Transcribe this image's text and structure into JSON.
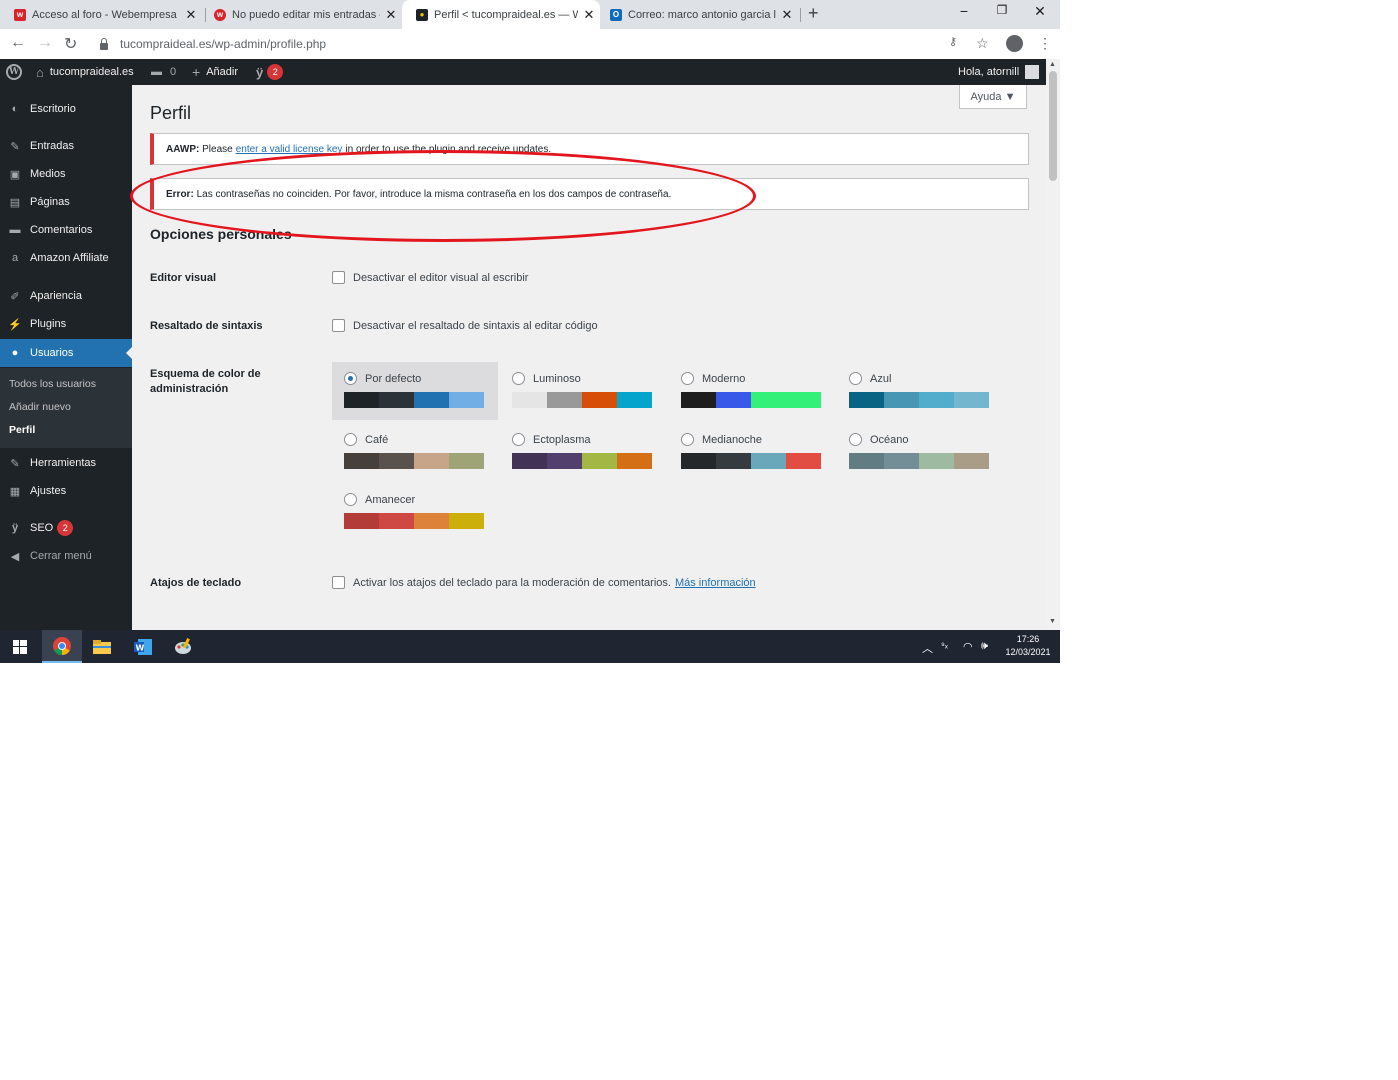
{
  "browser": {
    "tabs": [
      {
        "title": "Acceso al foro - Webempresa Eu",
        "favicon_color": "#d8232a",
        "favicon_glyph": "w"
      },
      {
        "title": "No puedo editar mis entradas – I",
        "favicon_color": "#d8232a",
        "favicon_glyph": "w"
      },
      {
        "title": "Perfil < tucompraideal.es — Wor",
        "favicon_color": "#1d2327",
        "favicon_glyph": "●"
      },
      {
        "title": "Correo: marco antonio garcia leo",
        "favicon_color": "#0f6cbd",
        "favicon_glyph": "O"
      }
    ],
    "new_tab": "+",
    "window_controls": {
      "minimize": "−",
      "restore": "❐",
      "close": "✕"
    },
    "url": "tucompraideal.es/wp-admin/profile.php"
  },
  "admin_bar": {
    "site_name": "tucompraideal.es",
    "comments_count": "0",
    "add_new": "Añadir",
    "seo_count": "2",
    "greeting": "Hola, atornill"
  },
  "sidebar": {
    "items": [
      {
        "label": "Escritorio",
        "icon": "dashboard-icon",
        "glyph": "◐"
      },
      {
        "label": "Entradas",
        "icon": "pin-icon",
        "glyph": "✎"
      },
      {
        "label": "Medios",
        "icon": "media-icon",
        "glyph": "▣"
      },
      {
        "label": "Páginas",
        "icon": "pages-icon",
        "glyph": "▤"
      },
      {
        "label": "Comentarios",
        "icon": "comment-icon",
        "glyph": "▬"
      },
      {
        "label": "Amazon Affiliate",
        "icon": "amazon-icon",
        "glyph": "a"
      },
      {
        "label": "Apariencia",
        "icon": "brush-icon",
        "glyph": "✐"
      },
      {
        "label": "Plugins",
        "icon": "plugin-icon",
        "glyph": "⚡"
      },
      {
        "label": "Usuarios",
        "icon": "users-icon",
        "glyph": "●"
      },
      {
        "label": "Herramientas",
        "icon": "wrench-icon",
        "glyph": "✎"
      },
      {
        "label": "Ajustes",
        "icon": "settings-icon",
        "glyph": "▦"
      },
      {
        "label": "SEO",
        "icon": "yoast-icon",
        "glyph": "ÿ",
        "badge": "2"
      },
      {
        "label": "Cerrar menú",
        "icon": "collapse-icon",
        "glyph": "◀"
      }
    ],
    "submenu": [
      "Todos los usuarios",
      "Añadir nuevo",
      "Perfil"
    ]
  },
  "content": {
    "help_label": "Ayuda ▼",
    "title": "Perfil",
    "notice_aawp": {
      "strong": "AAWP:",
      "before": "Please",
      "link": "enter a valid license key",
      "after": "in order to use the plugin and receive updates."
    },
    "notice_error": {
      "strong": "Error:",
      "text": "Las contraseñas no coinciden. Por favor, introduce la misma contraseña en los dos campos de contraseña."
    },
    "section_title": "Opciones personales",
    "editor_visual": {
      "label": "Editor visual",
      "option": "Desactivar el editor visual al escribir"
    },
    "syntax": {
      "label": "Resaltado de sintaxis",
      "option": "Desactivar el resaltado de sintaxis al editar código"
    },
    "color_scheme_label": "Esquema de color de administración",
    "color_schemes": [
      {
        "name": "Por defecto",
        "selected": true,
        "colors": [
          "#1d2327",
          "#2c3338",
          "#2271b1",
          "#72aee6"
        ]
      },
      {
        "name": "Luminoso",
        "selected": false,
        "colors": [
          "#e5e5e5",
          "#999999",
          "#d64e07",
          "#04a4cc"
        ]
      },
      {
        "name": "Moderno",
        "selected": false,
        "colors": [
          "#1e1e1e",
          "#3858e9",
          "#33f078",
          "#33f078"
        ]
      },
      {
        "name": "Azul",
        "selected": false,
        "colors": [
          "#096484",
          "#4796b3",
          "#52accc",
          "#74b6ce"
        ]
      },
      {
        "name": "Café",
        "selected": false,
        "colors": [
          "#46403c",
          "#59524c",
          "#c7a589",
          "#9ea476"
        ]
      },
      {
        "name": "Ectoplasma",
        "selected": false,
        "colors": [
          "#413256",
          "#523f6d",
          "#a3b745",
          "#d46f15"
        ]
      },
      {
        "name": "Medianoche",
        "selected": false,
        "colors": [
          "#25282b",
          "#363b3f",
          "#69a8bb",
          "#e14d43"
        ]
      },
      {
        "name": "Océano",
        "selected": false,
        "colors": [
          "#627c83",
          "#738e96",
          "#9ebaa0",
          "#aa9d88"
        ]
      },
      {
        "name": "Amanecer",
        "selected": false,
        "colors": [
          "#b43c38",
          "#cf4944",
          "#dd823b",
          "#ccaf0b"
        ]
      }
    ],
    "shortcuts": {
      "label": "Atajos de teclado",
      "option": "Activar los atajos del teclado para la moderación de comentarios.",
      "link": "Más información"
    }
  },
  "taskbar": {
    "time": "17:26",
    "date": "12/03/2021"
  }
}
